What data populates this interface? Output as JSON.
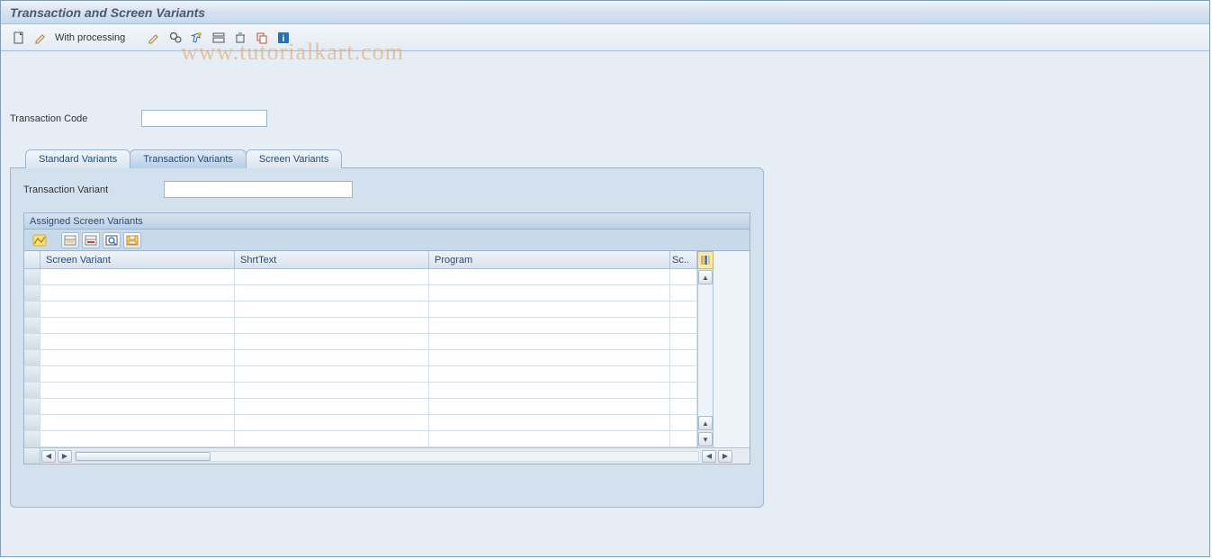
{
  "title": "Transaction and Screen Variants",
  "toolbar": {
    "with_processing_label": "With processing"
  },
  "watermark": "www.tutorialkart.com",
  "fields": {
    "transaction_code_label": "Transaction Code",
    "transaction_code_value": "",
    "transaction_variant_label": "Transaction Variant",
    "transaction_variant_value": ""
  },
  "tabs": {
    "standard": "Standard Variants",
    "transaction": "Transaction Variants",
    "screen": "Screen Variants",
    "active": "transaction"
  },
  "subgroup": {
    "title": "Assigned Screen Variants"
  },
  "grid": {
    "columns": {
      "c1": "Screen Variant",
      "c2": "ShrtText",
      "c3": "Program",
      "c4": "Sc.."
    },
    "rows": [
      {
        "c1": "",
        "c2": "",
        "c3": "",
        "c4": ""
      },
      {
        "c1": "",
        "c2": "",
        "c3": "",
        "c4": ""
      },
      {
        "c1": "",
        "c2": "",
        "c3": "",
        "c4": ""
      },
      {
        "c1": "",
        "c2": "",
        "c3": "",
        "c4": ""
      },
      {
        "c1": "",
        "c2": "",
        "c3": "",
        "c4": ""
      },
      {
        "c1": "",
        "c2": "",
        "c3": "",
        "c4": ""
      },
      {
        "c1": "",
        "c2": "",
        "c3": "",
        "c4": ""
      },
      {
        "c1": "",
        "c2": "",
        "c3": "",
        "c4": ""
      },
      {
        "c1": "",
        "c2": "",
        "c3": "",
        "c4": ""
      },
      {
        "c1": "",
        "c2": "",
        "c3": "",
        "c4": ""
      },
      {
        "c1": "",
        "c2": "",
        "c3": "",
        "c4": ""
      }
    ]
  }
}
